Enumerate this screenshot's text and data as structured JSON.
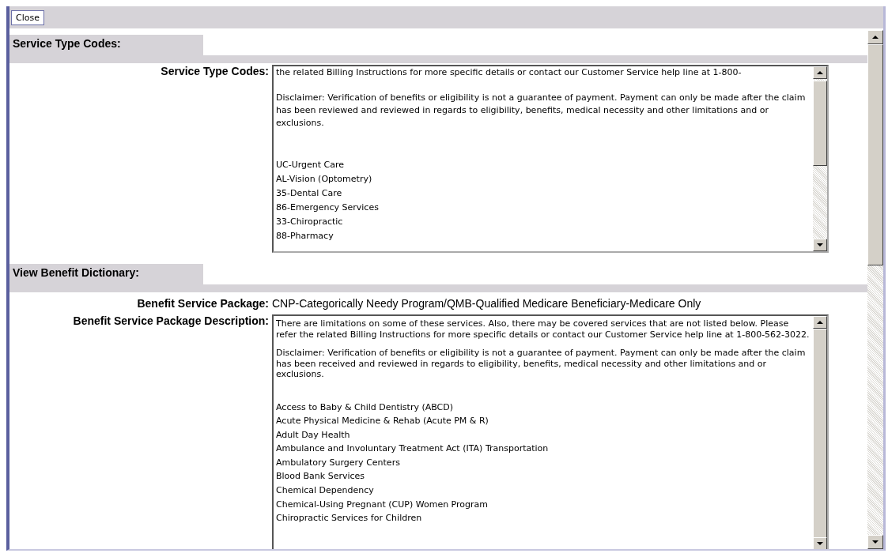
{
  "toolbar": {
    "close_button": "Close"
  },
  "sections": [
    {
      "heading": "Service Type Codes:",
      "fields": [
        {
          "kind": "textarea",
          "label": "Service Type Codes:",
          "paragraphs": [
            "the related Billing Instructions for more specific details or contact our Customer Service help line at 1-800-",
            "Disclaimer: Verification of benefits or eligibility is not a guarantee of payment. Payment can only be made after the claim has been reviewed and reviewed in regards to eligibility, benefits, medical necessity and other limitations and or exclusions."
          ],
          "items": [
            "UC-Urgent Care",
            "AL-Vision (Optometry)",
            "35-Dental Care",
            "86-Emergency Services",
            "33-Chiropractic",
            "88-Pharmacy"
          ]
        }
      ]
    },
    {
      "heading": "View Benefit Dictionary:",
      "fields": [
        {
          "kind": "text",
          "label": "Benefit Service Package:",
          "value": "CNP-Categorically Needy Program/QMB-Qualified Medicare Beneficiary-Medicare Only"
        },
        {
          "kind": "textarea",
          "label": "Benefit Service Package Description:",
          "paragraphs": [
            "There are limitations on some of these services. Also, there may be covered services that are not listed below. Please refer the related Billing Instructions for more specific details or contact our Customer Service help line at 1-800-562-3022.",
            "Disclaimer: Verification of benefits or eligibility is not a guarantee of payment. Payment can only be made after the claim has been received and reviewed in regards to eligibility, benefits, medical necessity and other limitations and or exclusions."
          ],
          "items": [
            "Access to Baby & Child Dentistry (ABCD)",
            "Acute Physical Medicine & Rehab (Acute PM & R)",
            "Adult Day Health",
            "Ambulance and Involuntary Treatment Act (ITA) Transportation",
            "Ambulatory Surgery Centers",
            "Blood Bank Services",
            "Chemical Dependency",
            "Chemical-Using Pregnant (CUP) Women Program",
            "Chiropractic Services for Children"
          ]
        }
      ]
    }
  ]
}
